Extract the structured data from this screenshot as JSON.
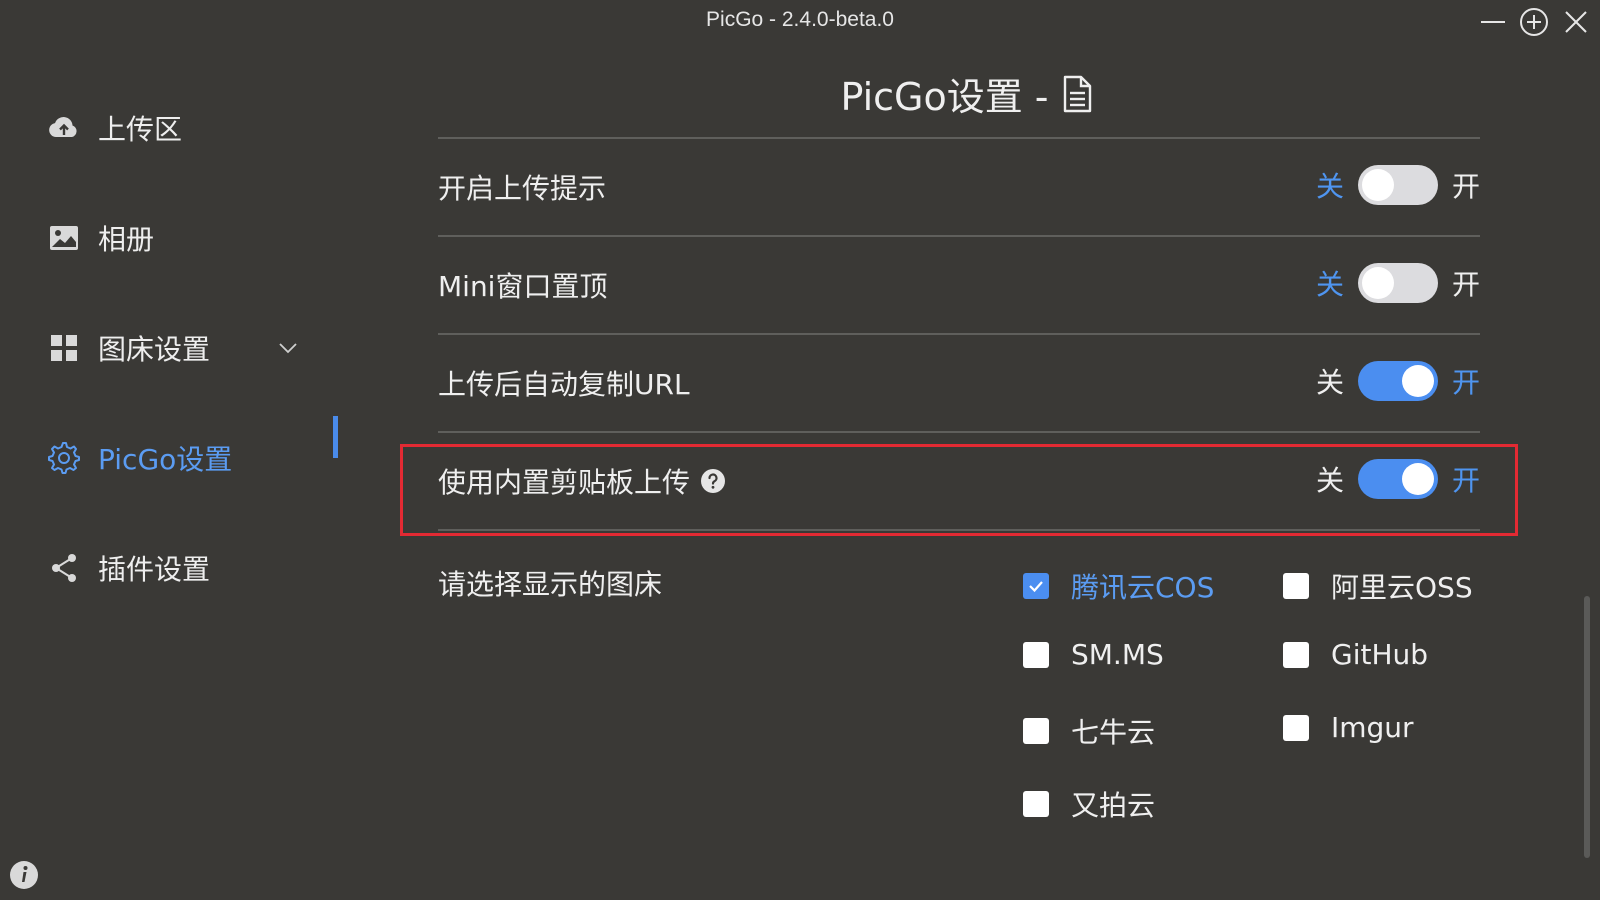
{
  "window": {
    "title": "PicGo - 2.4.0-beta.0"
  },
  "sidebar": {
    "items": [
      {
        "label": "上传区",
        "icon": "cloud-upload-icon"
      },
      {
        "label": "相册",
        "icon": "image-icon"
      },
      {
        "label": "图床设置",
        "icon": "grid-icon"
      },
      {
        "label": "PicGo设置",
        "icon": "gear-icon"
      },
      {
        "label": "插件设置",
        "icon": "share-icon"
      }
    ]
  },
  "main": {
    "title": "PicGo设置 -",
    "settings": [
      {
        "label": "开启上传提示",
        "off_text": "关",
        "on_text": "开",
        "value": "off"
      },
      {
        "label": "Mini窗口置顶",
        "off_text": "关",
        "on_text": "开",
        "value": "off"
      },
      {
        "label": "上传后自动复制URL",
        "off_text": "关",
        "on_text": "开",
        "value": "on"
      },
      {
        "label": "使用内置剪贴板上传",
        "off_text": "关",
        "on_text": "开",
        "value": "on"
      }
    ],
    "picbed_label": "请选择显示的图床",
    "picbeds": [
      {
        "label": "腾讯云COS",
        "checked": true
      },
      {
        "label": "阿里云OSS",
        "checked": false
      },
      {
        "label": "SM.MS",
        "checked": false
      },
      {
        "label": "GitHub",
        "checked": false
      },
      {
        "label": "七牛云",
        "checked": false
      },
      {
        "label": "Imgur",
        "checked": false
      },
      {
        "label": "又拍云",
        "checked": false
      }
    ]
  },
  "colors": {
    "accent": "#4b8ef0",
    "highlight": "#e32a33",
    "background": "#3a3936"
  }
}
